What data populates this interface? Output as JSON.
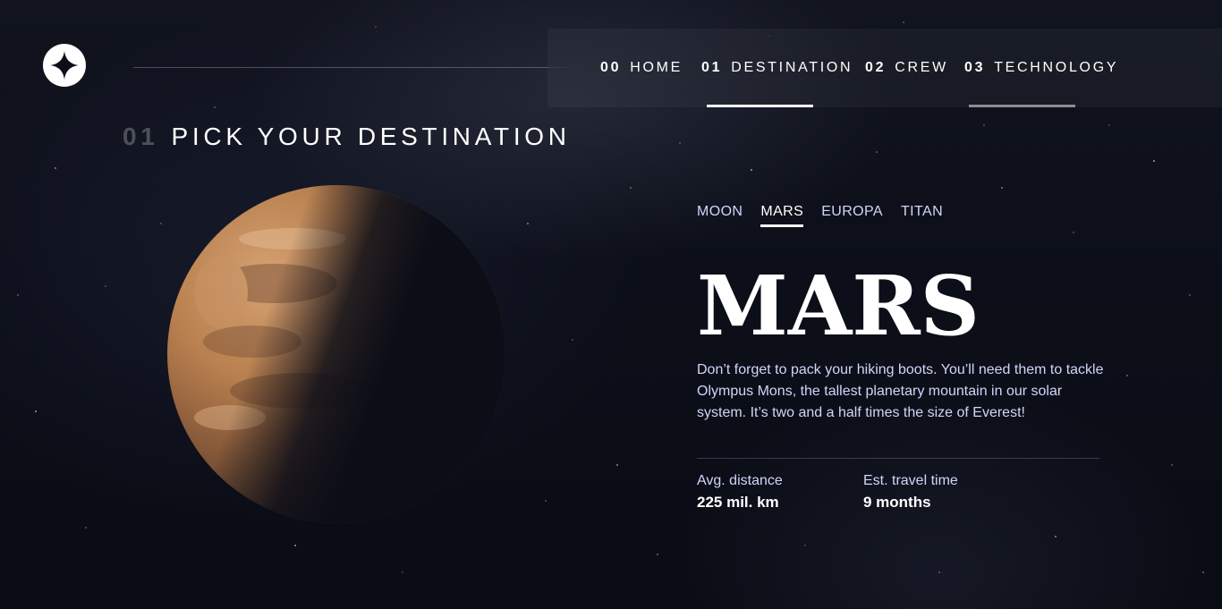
{
  "nav": {
    "items": [
      {
        "num": "00",
        "label": "HOME"
      },
      {
        "num": "01",
        "label": "DESTINATION"
      },
      {
        "num": "02",
        "label": "CREW"
      },
      {
        "num": "03",
        "label": "TECHNOLOGY"
      }
    ],
    "active_index": 1
  },
  "page": {
    "heading_num": "01",
    "heading_text": "PICK YOUR DESTINATION"
  },
  "destination": {
    "tabs": [
      "MOON",
      "MARS",
      "EUROPA",
      "TITAN"
    ],
    "active_tab": "MARS",
    "name": "MARS",
    "description": "Don’t forget to pack your hiking boots. You’ll need them to tackle Olympus Mons, the tallest planetary mountain in our solar system. It’s two and a half times the size of Everest!",
    "stats": {
      "distance_label": "Avg. distance",
      "distance_value": "225 mil. km",
      "travel_label": "Est. travel time",
      "travel_value": "9 months"
    }
  },
  "icons": {
    "logo": "four-point-star-logo-icon",
    "planet": "mars-planet-image"
  },
  "colors": {
    "background": "#0b0d17",
    "text_primary": "#ffffff",
    "text_secondary": "#d0d6f9",
    "planet_light": "#c98e5a"
  }
}
